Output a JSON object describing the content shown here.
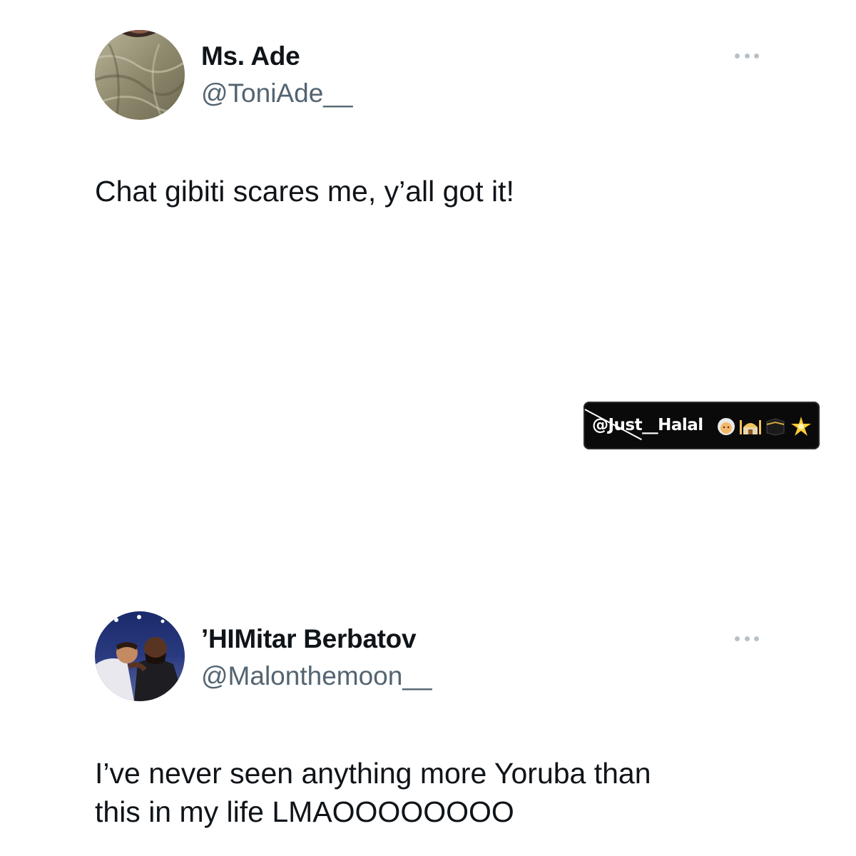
{
  "tweets": [
    {
      "display_name": "Ms. Ade",
      "handle": "@ToniAde__",
      "text_lines": [
        "Chat gibiti scares me, y’all got it!"
      ]
    },
    {
      "display_name": "’HIMitar Berbatov",
      "handle": "@Malonthemoon__",
      "text_lines": [
        "I’ve never seen anything more Yoruba than",
        "this in my life LMAOOOOOOOO"
      ]
    }
  ],
  "watermark": {
    "text": "@Just__Halal",
    "icons": [
      "grandmother-emoji-icon",
      "mosque-emoji-icon",
      "kaaba-emoji-icon",
      "sparkle-star-emoji-icon"
    ]
  },
  "icons": {
    "more_options": "more-horizontal-icon"
  },
  "colors": {
    "text_primary": "#0f1419",
    "text_secondary": "#536471",
    "more_dots": "#b9c1c8",
    "background": "#ffffff",
    "watermark_bg": "#0a0a0a"
  }
}
